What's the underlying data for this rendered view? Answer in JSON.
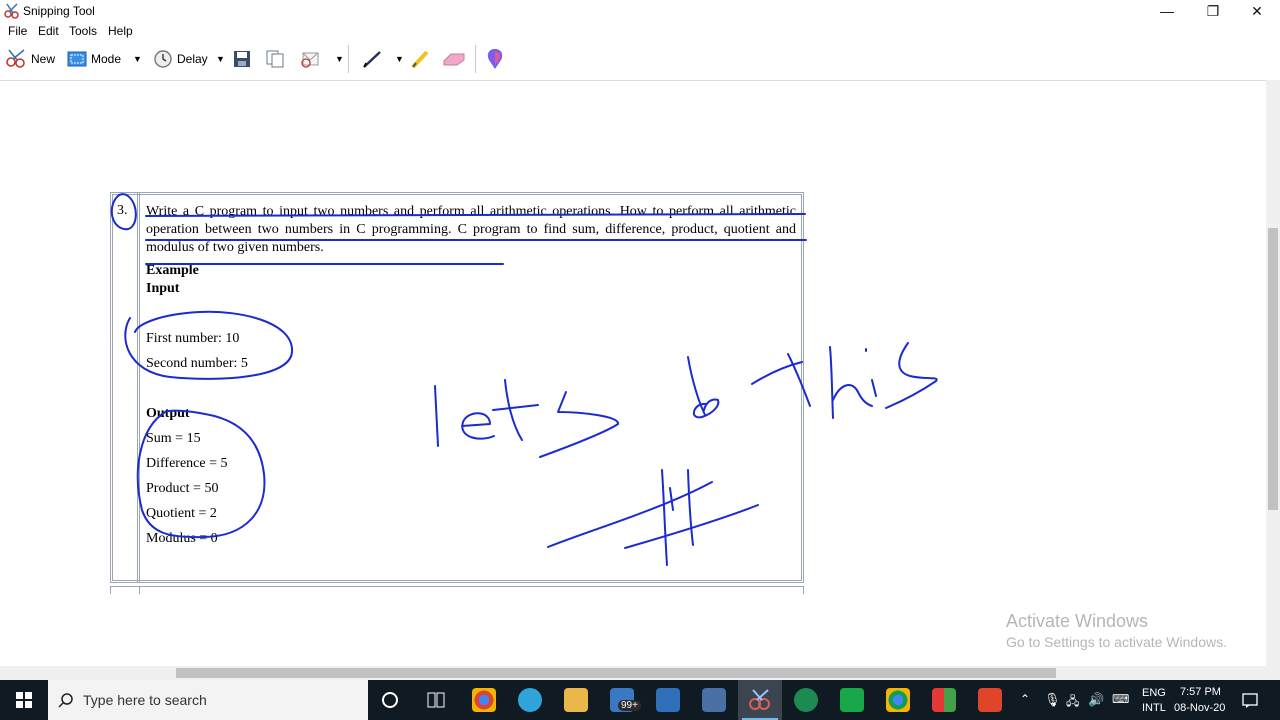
{
  "window": {
    "title": "Snipping Tool",
    "controls": {
      "minimize": "—",
      "maximize": "❐",
      "close": "✕"
    }
  },
  "menu": [
    "File",
    "Edit",
    "Tools",
    "Help"
  ],
  "toolbar": {
    "new_label": "New",
    "mode_label": "Mode",
    "delay_label": "Delay"
  },
  "document": {
    "number": "3.",
    "question": "Write a C program to input two numbers and perform all arithmetic operations. How to perform all arithmetic operation between two numbers in C programming. C program to find sum, difference, product, quotient and modulus of two given numbers.",
    "example": "Example",
    "input": "Input",
    "first": "First number: 10",
    "second": "Second number: 5",
    "output": "Output",
    "sum": "Sum = 15",
    "difference": "Difference = 5",
    "product": "Product = 50",
    "quotient": "Quotient = 2",
    "modulus": "Modulus = 0"
  },
  "watermark": {
    "title": "Activate Windows",
    "subtitle": "Go to Settings to activate Windows."
  },
  "taskbar": {
    "search_placeholder": "Type here to search",
    "badge": "99+",
    "lang1": "ENG",
    "lang2": "INTL",
    "time": "7:57 PM",
    "date": "08-Nov-20"
  },
  "colors": {
    "ink": "#1c2bd0",
    "accent": "#0078d7",
    "taskbar": "#101a22"
  }
}
